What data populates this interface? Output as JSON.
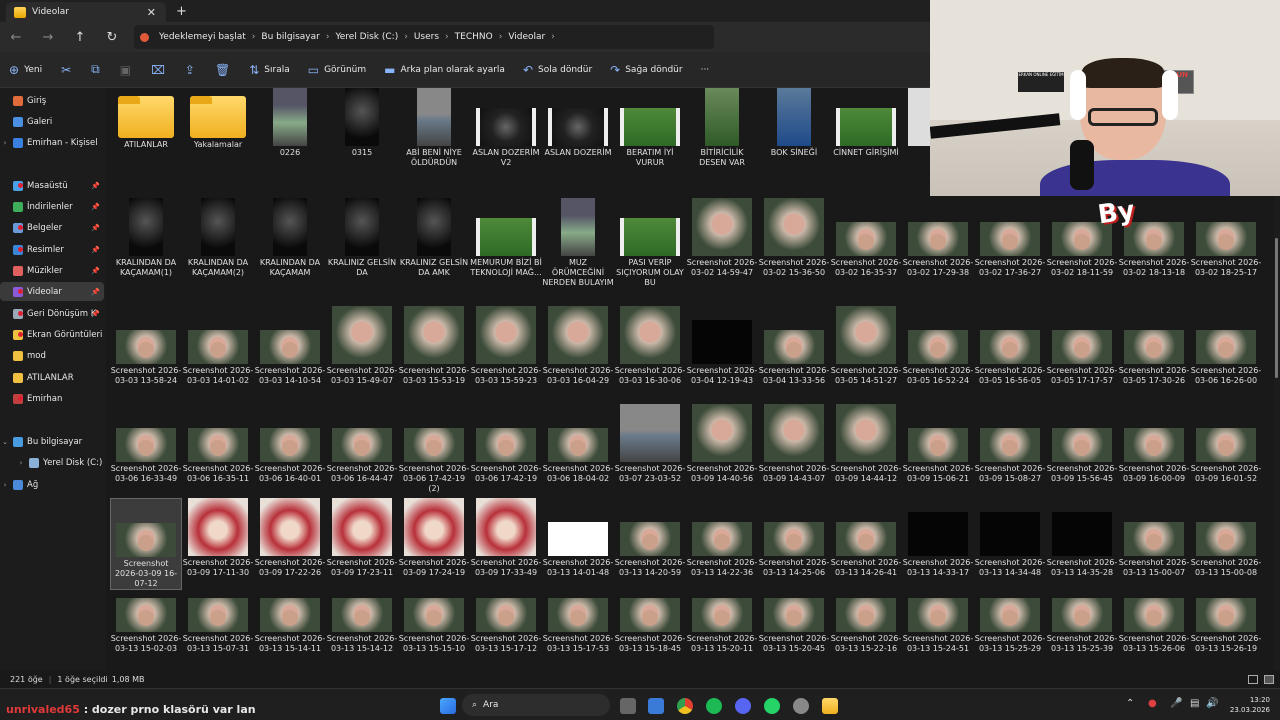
{
  "window": {
    "tab_title": "Videolar",
    "close": "✕",
    "new_tab": "+"
  },
  "nav": {
    "back": "←",
    "forward": "→",
    "up": "↑",
    "refresh": "↻"
  },
  "address": {
    "crumbs": [
      "Yedeklemeyi başlat",
      "Bu bilgisayar",
      "Yerel Disk (C:)",
      "Users",
      "TECHNO",
      "Videolar"
    ],
    "sep": "›"
  },
  "toolbar": {
    "new": "Yeni",
    "sort": "Sırala",
    "view": "Görünüm",
    "set_bg": "Arka plan olarak ayarla",
    "rotate_left": "Sola döndür",
    "rotate_right": "Sağa döndür",
    "more": "···"
  },
  "sidebar": {
    "items": [
      {
        "label": "Giriş",
        "color": "#e26b3c"
      },
      {
        "label": "Galeri",
        "color": "#4b8fe0"
      },
      {
        "label": "Emirhan - Kişisel",
        "color": "#3a80e0"
      },
      {
        "label": "Masaüstü",
        "color": "#4aa0e8"
      },
      {
        "label": "İndirilenler",
        "color": "#3fae5a"
      },
      {
        "label": "Belgeler",
        "color": "#6a9ad8"
      },
      {
        "label": "Resimler",
        "color": "#3a86d8"
      },
      {
        "label": "Müzikler",
        "color": "#e06060"
      },
      {
        "label": "Videolar",
        "color": "#8a5ad8"
      },
      {
        "label": "Geri Dönüşüm K",
        "color": "#9aa8b8"
      },
      {
        "label": "Ekran Görüntüleri",
        "color": "#f0c040"
      },
      {
        "label": "mod",
        "color": "#f0c040"
      },
      {
        "label": "ATILANLAR",
        "color": "#f0c040"
      },
      {
        "label": "Emirhan",
        "color": "#c04040"
      },
      {
        "label": "Bu bilgisayar",
        "color": "#4a9ae0"
      },
      {
        "label": "Yerel Disk (C:)",
        "color": "#8ab0d8"
      },
      {
        "label": "Ağ",
        "color": "#4a8ad8"
      }
    ]
  },
  "files": [
    [
      "ATILANLAR"
    ],
    [
      "Yakalamalar"
    ],
    [
      "0226"
    ],
    [
      "0315"
    ],
    [
      "ABİ BENİ NİYE ÖLDÜRDÜN"
    ],
    [
      "ASLAN DOZERİM V2"
    ],
    [
      "ASLAN DOZERİM"
    ],
    [
      "BERATIM İYİ VURUR"
    ],
    [
      "BİTİRİCİLİK DESEN VAR"
    ],
    [
      "BOK SİNEĞİ"
    ],
    [
      "CİNNET GİRİŞİMİ"
    ],
    [
      "DO"
    ],
    [
      "KRALINDAN DA KAÇAMAM(1)"
    ],
    [
      "KRALINDAN DA KAÇAMAM(2)"
    ],
    [
      "KRALINDAN DA KAÇAMAM"
    ],
    [
      "KRALINIZ GELSİN DA"
    ],
    [
      "KRALINIZ GELSİN DA AMK"
    ],
    [
      "MEMURUM BİZİ Bİ TEKNOLOJİ MAĞ..."
    ],
    [
      "MUZ ÖRÜMCEĞİNİ NERDEN BULAYIM"
    ],
    [
      "PASI VERİP SIÇIYORUM OLAY BU"
    ],
    [
      "Screenshot 2026-03-02 14-59-47"
    ],
    [
      "Screenshot 2026-03-02 15-36-50"
    ],
    [
      "Screenshot 2026-03-02 16-35-37"
    ],
    [
      "Screenshot 2026-03-02 17-29-38"
    ],
    [
      "Screenshot 2026-03-02 17-36-27"
    ],
    [
      "Screenshot 2026-03-02 18-11-59"
    ],
    [
      "Screenshot 2026-03-02 18-13-18"
    ],
    [
      "Screenshot 2026-03-02 18-25-17"
    ],
    [
      "Screenshot 2026-03-03 13-58-24"
    ],
    [
      "Screenshot 2026-03-03 14-01-02"
    ],
    [
      "Screenshot 2026-03-03 14-10-54"
    ],
    [
      "Screenshot 2026-03-03 15-49-07"
    ],
    [
      "Screenshot 2026-03-03 15-53-19"
    ],
    [
      "Screenshot 2026-03-03 15-59-23"
    ],
    [
      "Screenshot 2026-03-03 16-04-29"
    ],
    [
      "Screenshot 2026-03-03 16-30-06"
    ],
    [
      "Screenshot 2026-03-04 12-19-43"
    ],
    [
      "Screenshot 2026-03-04 13-33-56"
    ],
    [
      "Screenshot 2026-03-05 14-51-27"
    ],
    [
      "Screenshot 2026-03-05 16-52-24"
    ],
    [
      "Screenshot 2026-03-05 16-56-05"
    ],
    [
      "Screenshot 2026-03-05 17-17-57"
    ],
    [
      "Screenshot 2026-03-05 17-30-26"
    ],
    [
      "Screenshot 2026-03-06 16-26-00"
    ],
    [
      "Screenshot 2026-03-06 16-33-49"
    ],
    [
      "Screenshot 2026-03-06 16-35-11"
    ],
    [
      "Screenshot 2026-03-06 16-40-01"
    ],
    [
      "Screenshot 2026-03-06 16-44-47"
    ],
    [
      "Screenshot 2026-03-06 17-42-19 (2)"
    ],
    [
      "Screenshot 2026-03-06 17-42-19"
    ],
    [
      "Screenshot 2026-03-06 18-04-02"
    ],
    [
      "Screenshot 2026-03-07 23-03-52"
    ],
    [
      "Screenshot 2026-03-09 14-40-56"
    ],
    [
      "Screenshot 2026-03-09 14-43-07"
    ],
    [
      "Screenshot 2026-03-09 14-44-12"
    ],
    [
      "Screenshot 2026-03-09 15-06-21"
    ],
    [
      "Screenshot 2026-03-09 15-08-27"
    ],
    [
      "Screenshot 2026-03-09 15-56-45"
    ],
    [
      "Screenshot 2026-03-09 16-00-09"
    ],
    [
      "Screenshot 2026-03-09 16-01-52"
    ],
    [
      "Screenshot 2026-03-09 16-07-12"
    ],
    [
      "Screenshot 2026-03-09 17-11-30"
    ],
    [
      "Screenshot 2026-03-09 17-22-26"
    ],
    [
      "Screenshot 2026-03-09 17-23-11"
    ],
    [
      "Screenshot 2026-03-09 17-24-19"
    ],
    [
      "Screenshot 2026-03-09 17-33-49"
    ],
    [
      "Screenshot 2026-03-13 14-01-48"
    ],
    [
      "Screenshot 2026-03-13 14-20-59"
    ],
    [
      "Screenshot 2026-03-13 14-22-36"
    ],
    [
      "Screenshot 2026-03-13 14-25-06"
    ],
    [
      "Screenshot 2026-03-13 14-26-41"
    ],
    [
      "Screenshot 2026-03-13 14-33-17"
    ],
    [
      "Screenshot 2026-03-13 14-34-48"
    ],
    [
      "Screenshot 2026-03-13 14-35-28"
    ],
    [
      "Screenshot 2026-03-13 15-00-07"
    ],
    [
      "Screenshot 2026-03-13 15-00-08"
    ],
    [
      "Screenshot 2026-03-13 15-02-03"
    ],
    [
      "Screenshot 2026-03-13 15-07-31"
    ],
    [
      "Screenshot 2026-03-13 15-14-11"
    ],
    [
      "Screenshot 2026-03-13 15-14-12"
    ],
    [
      "Screenshot 2026-03-13 15-15-10"
    ],
    [
      "Screenshot 2026-03-13 15-17-12"
    ],
    [
      "Screenshot 2026-03-13 15-17-53"
    ],
    [
      "Screenshot 2026-03-13 15-18-45"
    ],
    [
      "Screenshot 2026-03-13 15-20-11"
    ],
    [
      "Screenshot 2026-03-13 15-20-45"
    ],
    [
      "Screenshot 2026-03-13 15-22-16"
    ],
    [
      "Screenshot 2026-03-13 15-24-51"
    ],
    [
      "Screenshot 2026-03-13 15-25-29"
    ],
    [
      "Screenshot 2026-03-13 15-25-39"
    ],
    [
      "Screenshot 2026-03-13 15-26-06"
    ],
    [
      "Screenshot 2026-03-13 15-26-19"
    ]
  ],
  "status": {
    "count": "221 öğe",
    "selected": "1 öğe seçildi",
    "size": "1,08 MB"
  },
  "taskbar": {
    "search": "Ara",
    "chat_user": "unrivaled65",
    "chat_msg": " : dozer prno klasörü var lan"
  },
  "clock": {
    "time": "13:20",
    "date": "23.03.2026"
  },
  "overlay": {
    "sticker": "By",
    "sign1": "ERKAN ONLINE EĞİTİM",
    "sign2": "SAMSUN"
  },
  "colors": {
    "accent": "#8ab4f8",
    "folder": "#f0b020",
    "notify": "#e02030"
  }
}
